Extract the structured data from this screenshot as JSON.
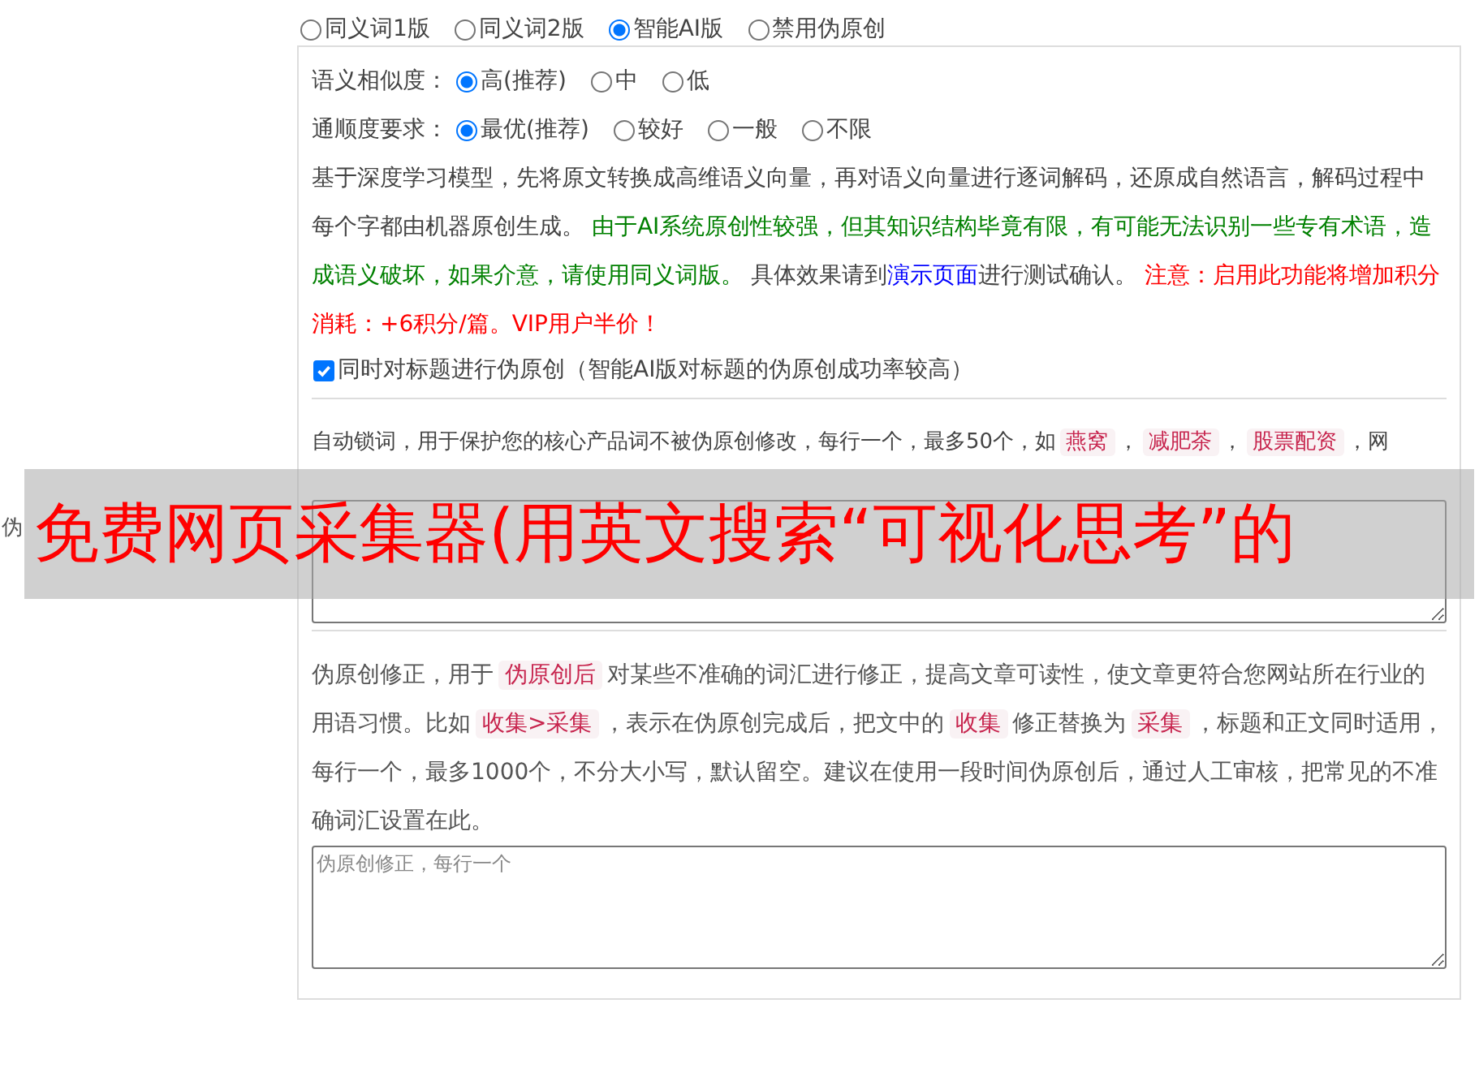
{
  "modes": [
    {
      "label": "同义词1版",
      "selected": false
    },
    {
      "label": "同义词2版",
      "selected": false
    },
    {
      "label": "智能AI版",
      "selected": true
    },
    {
      "label": "禁用伪原创",
      "selected": false
    }
  ],
  "similarity": {
    "label": "语义相似度：",
    "options": [
      {
        "label": "高(推荐)",
        "selected": true
      },
      {
        "label": "中",
        "selected": false
      },
      {
        "label": "低",
        "selected": false
      }
    ]
  },
  "fluency": {
    "label": "通顺度要求：",
    "options": [
      {
        "label": "最优(推荐)",
        "selected": true
      },
      {
        "label": "较好",
        "selected": false
      },
      {
        "label": "一般",
        "selected": false
      },
      {
        "label": "不限",
        "selected": false
      }
    ]
  },
  "description": [
    {
      "kind": "plain",
      "text": "基于深度学习模型，先将原文转换成高维语义向量，再对语义向量进行逐词解码，还原成自然语言，解码过程中每个字都由机器原创生成。 "
    },
    {
      "kind": "green",
      "text": "由于AI系统原创性较强，但其知识结构毕竟有限，有可能无法识别一些专有术语，造成语义破坏，如果介意，请使用同义词版。"
    },
    {
      "kind": "plain",
      "text": " 具体效果请到"
    },
    {
      "kind": "link",
      "text": "演示页面"
    },
    {
      "kind": "plain",
      "text": "进行测试确认。 "
    },
    {
      "kind": "red",
      "text": "注意：启用此功能将增加积分消耗：+6积分/篇。VIP用户半价！"
    }
  ],
  "title_option": {
    "label": "同时对标题进行伪原创（智能AI版对标题的伪原创成功率较高）",
    "checked": true
  },
  "side_label": "伪",
  "auto_lock": {
    "text": [
      {
        "kind": "plain",
        "text": "自动锁词，用于保护您的核心产品词不被伪原创修改，每行一个，最多50个，如"
      },
      {
        "kind": "tag",
        "text": "燕窝"
      },
      {
        "kind": "plain",
        "text": "，"
      },
      {
        "kind": "tag",
        "text": "减肥茶"
      },
      {
        "kind": "plain",
        "text": "，"
      },
      {
        "kind": "tag",
        "text": "股票配资"
      },
      {
        "kind": "plain",
        "text": "，网"
      }
    ]
  },
  "correction": {
    "text": [
      {
        "kind": "plain",
        "text": "伪原创修正，用于"
      },
      {
        "kind": "tag",
        "text": "伪原创后"
      },
      {
        "kind": "plain",
        "text": "对某些不准确的词汇进行修正，提高文章可读性，使文章更符合您网站所在行业的用语习惯。比如"
      },
      {
        "kind": "tag",
        "text": "收集>采集"
      },
      {
        "kind": "plain",
        "text": "，表示在伪原创完成后，把文中的"
      },
      {
        "kind": "tag",
        "text": "收集"
      },
      {
        "kind": "plain",
        "text": "修正替换为"
      },
      {
        "kind": "tag",
        "text": "采集"
      },
      {
        "kind": "plain",
        "text": "，标题和正文同时适用，每行一个，最多1000个，不分大小写，默认留空。建议在使用一段时间伪原创后，通过人工审核，把常见的不准确词汇设置在此。"
      }
    ],
    "placeholder": "伪原创修正，每行一个"
  },
  "overlay_banner": "免费网页采集器(用英文搜索“可视化思考”的"
}
